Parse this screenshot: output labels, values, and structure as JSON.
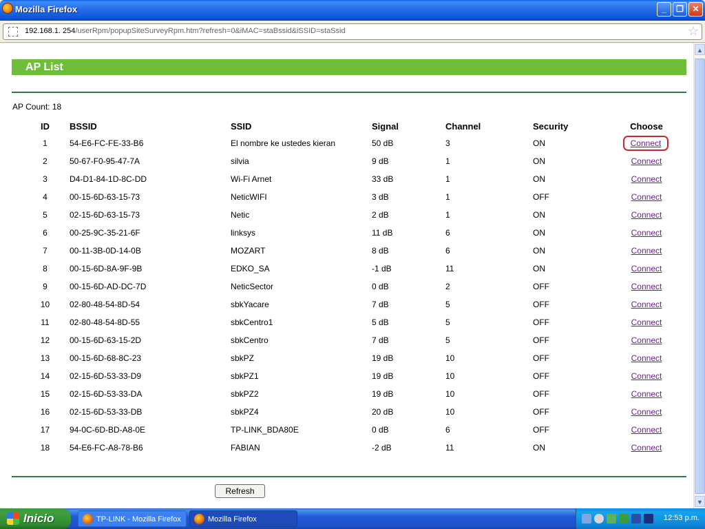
{
  "window": {
    "title": "Mozilla Firefox",
    "minimize": "_",
    "maximize": "❐",
    "close": "✕"
  },
  "address": {
    "host": "192.168.1. 254",
    "path": "/userRpm/popupSiteSurveyRpm.htm?refresh=0&iMAC=staBssid&iSSID=staSsid"
  },
  "page": {
    "header": "AP List",
    "ap_count_label": "AP Count: 18",
    "columns": {
      "id": "ID",
      "bssid": "BSSID",
      "ssid": "SSID",
      "signal": "Signal",
      "channel": "Channel",
      "security": "Security",
      "choose": "Choose"
    },
    "connect_label": "Connect",
    "refresh_label": "Refresh",
    "rows": [
      {
        "id": "1",
        "bssid": "54-E6-FC-FE-33-B6",
        "ssid": "El nombre ke ustedes kieran",
        "signal": "50 dB",
        "channel": "3",
        "security": "ON"
      },
      {
        "id": "2",
        "bssid": "50-67-F0-95-47-7A",
        "ssid": "silvia",
        "signal": "9 dB",
        "channel": "1",
        "security": "ON"
      },
      {
        "id": "3",
        "bssid": "D4-D1-84-1D-8C-DD",
        "ssid": "Wi-Fi Arnet",
        "signal": "33 dB",
        "channel": "1",
        "security": "ON"
      },
      {
        "id": "4",
        "bssid": "00-15-6D-63-15-73",
        "ssid": "NeticWIFI",
        "signal": "3 dB",
        "channel": "1",
        "security": "OFF"
      },
      {
        "id": "5",
        "bssid": "02-15-6D-63-15-73",
        "ssid": "Netic",
        "signal": "2 dB",
        "channel": "1",
        "security": "ON"
      },
      {
        "id": "6",
        "bssid": "00-25-9C-35-21-6F",
        "ssid": "linksys",
        "signal": "11 dB",
        "channel": "6",
        "security": "ON"
      },
      {
        "id": "7",
        "bssid": "00-11-3B-0D-14-0B",
        "ssid": "MOZART",
        "signal": "8 dB",
        "channel": "6",
        "security": "ON"
      },
      {
        "id": "8",
        "bssid": "00-15-6D-8A-9F-9B",
        "ssid": "EDKO_SA",
        "signal": "-1 dB",
        "channel": "11",
        "security": "ON"
      },
      {
        "id": "9",
        "bssid": "00-15-6D-AD-DC-7D",
        "ssid": "NeticSector",
        "signal": "0 dB",
        "channel": "2",
        "security": "OFF"
      },
      {
        "id": "10",
        "bssid": "02-80-48-54-8D-54",
        "ssid": "sbkYacare",
        "signal": "7 dB",
        "channel": "5",
        "security": "OFF"
      },
      {
        "id": "11",
        "bssid": "02-80-48-54-8D-55",
        "ssid": "sbkCentro1",
        "signal": "5 dB",
        "channel": "5",
        "security": "OFF"
      },
      {
        "id": "12",
        "bssid": "00-15-6D-63-15-2D",
        "ssid": "sbkCentro",
        "signal": "7 dB",
        "channel": "5",
        "security": "OFF"
      },
      {
        "id": "13",
        "bssid": "00-15-6D-68-8C-23",
        "ssid": "sbkPZ",
        "signal": "19 dB",
        "channel": "10",
        "security": "OFF"
      },
      {
        "id": "14",
        "bssid": "02-15-6D-53-33-D9",
        "ssid": "sbkPZ1",
        "signal": "19 dB",
        "channel": "10",
        "security": "OFF"
      },
      {
        "id": "15",
        "bssid": "02-15-6D-53-33-DA",
        "ssid": "sbkPZ2",
        "signal": "19 dB",
        "channel": "10",
        "security": "OFF"
      },
      {
        "id": "16",
        "bssid": "02-15-6D-53-33-DB",
        "ssid": "sbkPZ4",
        "signal": "20 dB",
        "channel": "10",
        "security": "OFF"
      },
      {
        "id": "17",
        "bssid": "94-0C-6D-BD-A8-0E",
        "ssid": "TP-LINK_BDA80E",
        "signal": "0 dB",
        "channel": "6",
        "security": "OFF"
      },
      {
        "id": "18",
        "bssid": "54-E6-FC-A8-78-B6",
        "ssid": "FABIAN",
        "signal": "-2 dB",
        "channel": "11",
        "security": "ON"
      }
    ]
  },
  "taskbar": {
    "start_label": "Inicio",
    "tasks": [
      "TP-LINK - Mozilla Firefox",
      "Mozilla Firefox"
    ],
    "clock": "12:53 p.m."
  },
  "colors": {
    "header_green": "#6ebe3a",
    "link_purple": "#6a1f8c",
    "highlight_red": "#c8282a"
  }
}
